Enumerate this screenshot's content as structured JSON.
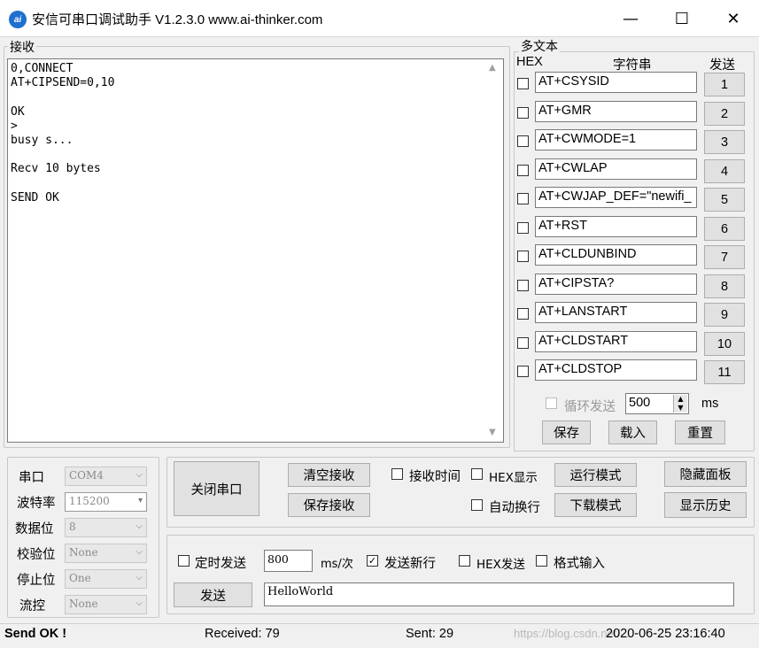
{
  "window": {
    "title": "安信可串口调试助手 V1.2.3.0    www.ai-thinker.com",
    "icon_text": "ai",
    "minimize": "—",
    "maximize": "☐",
    "close": "✕"
  },
  "receive": {
    "group_label": "接收",
    "text": "0,CONNECT\nAT+CIPSEND=0,10\n\nOK\n>\nbusy s...\n\nRecv 10 bytes\n\nSEND OK"
  },
  "multitext": {
    "group_label": "多文本",
    "col_hex": "HEX",
    "col_string": "字符串",
    "col_send": "发送",
    "items": [
      {
        "value": "AT+CSYSID",
        "btn": "1"
      },
      {
        "value": "AT+GMR",
        "btn": "2"
      },
      {
        "value": "AT+CWMODE=1",
        "btn": "3"
      },
      {
        "value": "AT+CWLAP",
        "btn": "4"
      },
      {
        "value": "AT+CWJAP_DEF=\"newifi_",
        "btn": "5"
      },
      {
        "value": "AT+RST",
        "btn": "6"
      },
      {
        "value": "AT+CLDUNBIND",
        "btn": "7"
      },
      {
        "value": "AT+CIPSTA?",
        "btn": "8"
      },
      {
        "value": "AT+LANSTART",
        "btn": "9"
      },
      {
        "value": "AT+CLDSTART",
        "btn": "10"
      },
      {
        "value": "AT+CLDSTOP",
        "btn": "11"
      }
    ],
    "loop_label": "循环发送",
    "loop_value": "500",
    "loop_unit": "ms",
    "save_btn": "保存",
    "load_btn": "载入",
    "reset_btn": "重置"
  },
  "serial": {
    "port_label": "串口",
    "port_value": "COM4",
    "baud_label": "波特率",
    "baud_value": "115200",
    "data_label": "数据位",
    "data_value": "8",
    "parity_label": "校验位",
    "parity_value": "None",
    "stop_label": "停止位",
    "stop_value": "One",
    "flow_label": "流控",
    "flow_value": "None"
  },
  "controls": {
    "close_port": "关闭串口",
    "clear_recv": "清空接收",
    "save_recv": "保存接收",
    "recv_time": "接收时间",
    "hex_display": "HEX显示",
    "auto_wrap": "自动换行",
    "run_mode": "运行模式",
    "download_mode": "下载模式",
    "hide_panel": "隐藏面板",
    "show_history": "显示历史"
  },
  "send": {
    "timed_send": "定时发送",
    "interval": "800",
    "interval_unit": "ms/次",
    "send_newline": "发送新行",
    "hex_send": "HEX发送",
    "format_input": "格式输入",
    "send_btn": "发送",
    "send_text": "HelloWorld"
  },
  "status": {
    "message": "Send OK !",
    "received": "Received: 79",
    "sent": "Sent: 29",
    "watermark": "https://blog.csdn.net/...",
    "datetime": "2020-06-25 23:16:40"
  }
}
